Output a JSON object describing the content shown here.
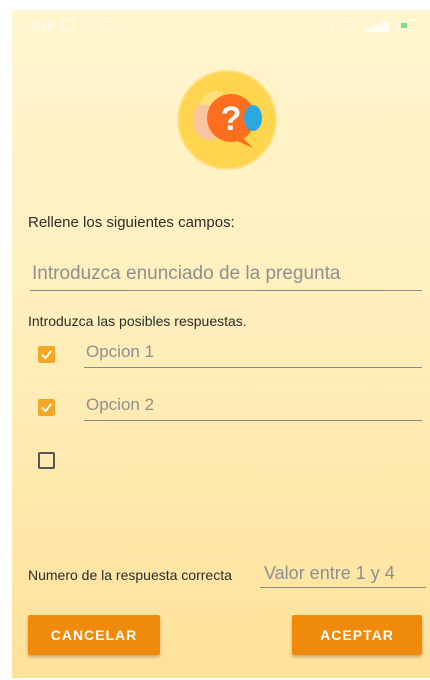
{
  "status_bar": {
    "time": "16:39"
  },
  "form": {
    "instructions": "Rellene los siguientes campos:",
    "question_placeholder": "Introduzca enunciado de la pregunta",
    "answers_label": "Introduzca las posibles respuestas.",
    "options": [
      {
        "placeholder": "Opcion 1",
        "checked": true
      },
      {
        "placeholder": "Opcion 2",
        "checked": true
      },
      {
        "placeholder": "",
        "checked": false
      }
    ],
    "correct_label": "Numero de la respuesta correcta",
    "correct_placeholder": "Valor entre 1 y 4"
  },
  "buttons": {
    "cancel": "CANCELAR",
    "accept": "ACEPTAR"
  },
  "colors": {
    "accent": "#f08a0a",
    "checkbox": "#f5a623"
  }
}
